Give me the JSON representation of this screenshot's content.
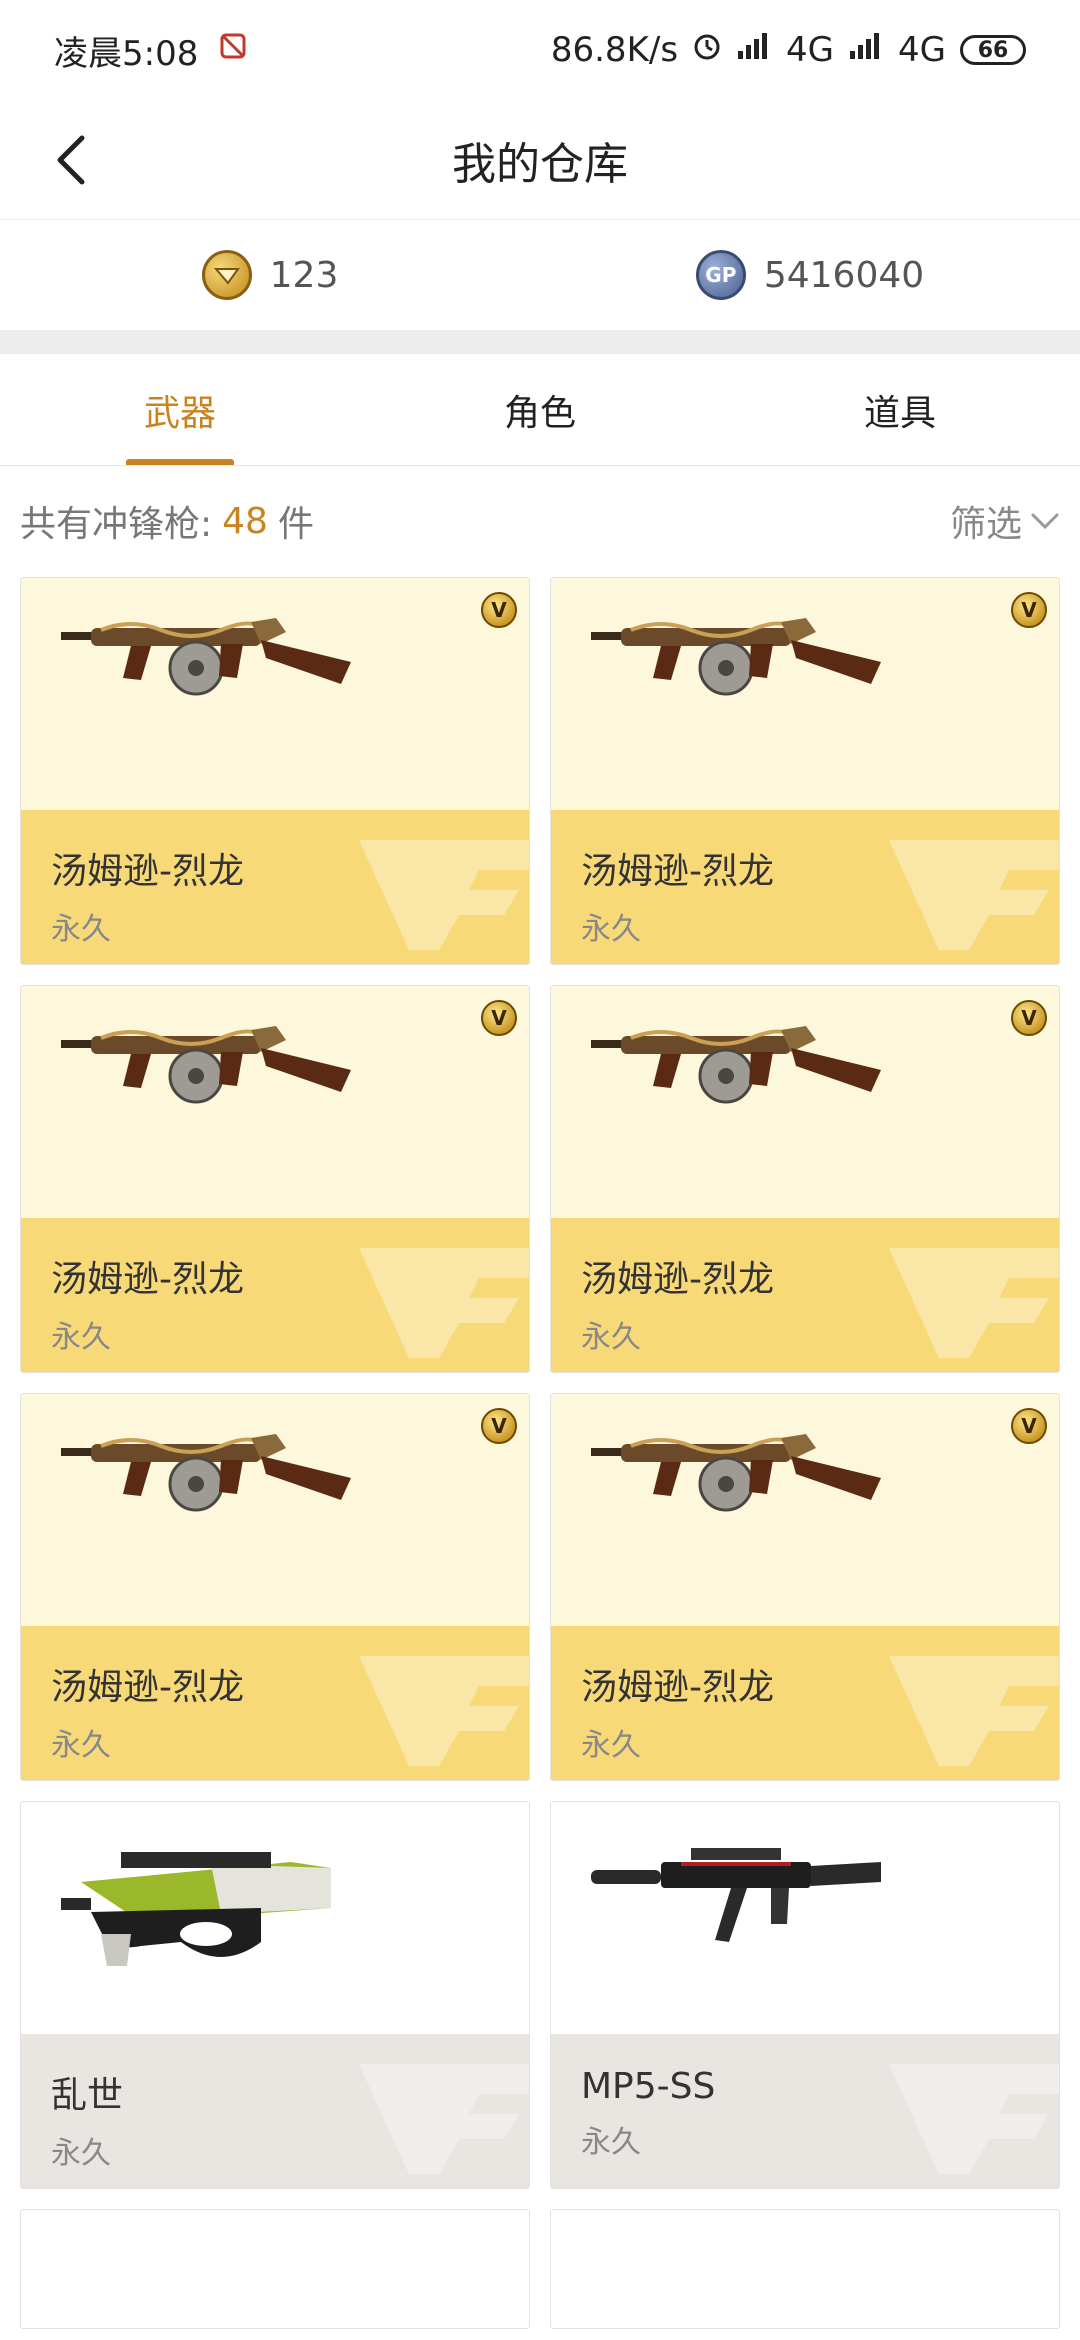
{
  "status_bar": {
    "time": "凌晨5:08",
    "speed": "86.8K/s",
    "network1": "4G",
    "network2": "4G",
    "battery": "66"
  },
  "header": {
    "title": "我的仓库"
  },
  "currency": {
    "cf_points": "123",
    "gp_points": "5416040"
  },
  "tabs": [
    {
      "label": "武器",
      "active": true
    },
    {
      "label": "角色",
      "active": false
    },
    {
      "label": "道具",
      "active": false
    }
  ],
  "summary": {
    "prefix": "共有冲锋枪:",
    "count": "48",
    "suffix": "件",
    "filter_label": "筛选"
  },
  "items": [
    {
      "name": "汤姆逊-烈龙",
      "duration": "永久",
      "vip": true,
      "gun": "thompson"
    },
    {
      "name": "汤姆逊-烈龙",
      "duration": "永久",
      "vip": true,
      "gun": "thompson"
    },
    {
      "name": "汤姆逊-烈龙",
      "duration": "永久",
      "vip": true,
      "gun": "thompson"
    },
    {
      "name": "汤姆逊-烈龙",
      "duration": "永久",
      "vip": true,
      "gun": "thompson"
    },
    {
      "name": "汤姆逊-烈龙",
      "duration": "永久",
      "vip": true,
      "gun": "thompson"
    },
    {
      "name": "汤姆逊-烈龙",
      "duration": "永久",
      "vip": true,
      "gun": "thompson"
    },
    {
      "name": "乱世",
      "duration": "永久",
      "vip": false,
      "gun": "p90"
    },
    {
      "name": "MP5-SS",
      "duration": "永久",
      "vip": false,
      "gun": "mp5"
    }
  ],
  "colors": {
    "accent": "#c98420",
    "card_top": "#fdf7dc",
    "card_bottom": "#f8d978",
    "card_bottom_normal": "#e9e6e2"
  }
}
